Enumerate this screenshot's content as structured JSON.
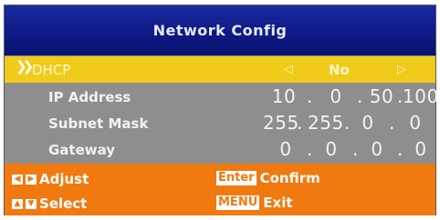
{
  "title": "Network Config",
  "dhcp": {
    "label": "DHCP",
    "value": "No",
    "left_arrow": "◁",
    "right_arrow": "▷"
  },
  "rows": [
    {
      "label": "IP Address",
      "octets": [
        "10",
        "0",
        "50",
        "100"
      ]
    },
    {
      "label": "Subnet Mask",
      "octets": [
        "255",
        "255",
        "0",
        "0"
      ]
    },
    {
      "label": "Gateway",
      "octets": [
        "0",
        "0",
        "0",
        "0"
      ]
    }
  ],
  "separator": ".",
  "footer": {
    "adjust_label": "Adjust",
    "select_label": "Select",
    "enter_key": "Enter",
    "confirm_label": "Confirm",
    "menu_key": "MENU",
    "exit_label": "Exit"
  },
  "colors": {
    "title_bar": "#0e1a86",
    "highlight": "#f0cb1a",
    "body": "#8e8e8e",
    "footer": "#f07a10"
  }
}
